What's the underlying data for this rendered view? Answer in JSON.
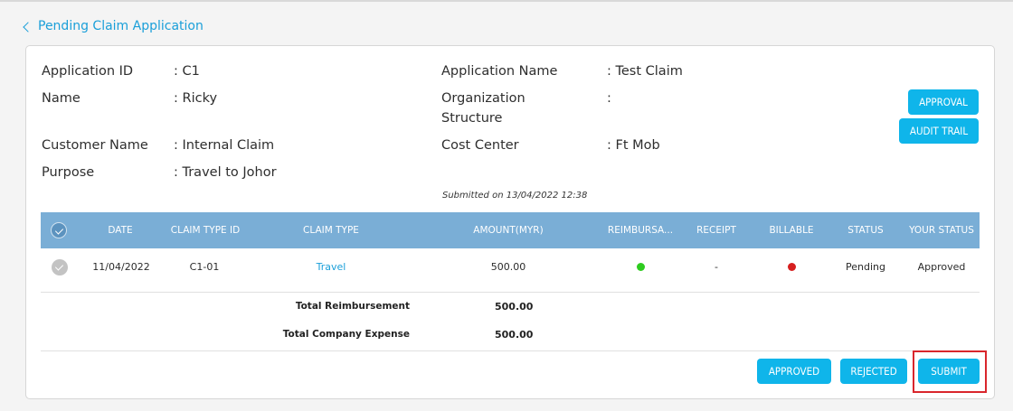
{
  "back": {
    "label": "Pending Claim Application"
  },
  "info": {
    "application_id": {
      "label": "Application ID",
      "value": ": C1"
    },
    "name": {
      "label": "Name",
      "value": ": Ricky"
    },
    "customer_name": {
      "label": "Customer Name",
      "value": ": Internal Claim"
    },
    "purpose": {
      "label": "Purpose",
      "value": ": Travel to Johor"
    },
    "application_name": {
      "label": "Application Name",
      "value": ": Test Claim"
    },
    "org_structure": {
      "label_line1": "Organization",
      "label_line2": "Structure",
      "value": ":"
    },
    "cost_center": {
      "label": "Cost Center",
      "value": ": Ft Mob"
    }
  },
  "buttons": {
    "approval": "APPROVAL",
    "audit_trail": "AUDIT TRAIL",
    "approved": "APPROVED",
    "rejected": "REJECTED",
    "submit": "SUBMIT"
  },
  "submitted_text": "Submitted on 13/04/2022 12:38",
  "table": {
    "headers": [
      "DATE",
      "CLAIM TYPE ID",
      "CLAIM TYPE",
      "AMOUNT(MYR)",
      "REIMBURSA...",
      "RECEIPT",
      "BILLABLE",
      "STATUS",
      "YOUR STATUS"
    ],
    "rows": [
      {
        "date": "11/04/2022",
        "claim_type_id": "C1-01",
        "claim_type": "Travel",
        "amount": "500.00",
        "reimbursable": "green",
        "receipt": "-",
        "billable": "red",
        "status": "Pending",
        "your_status": "Approved"
      }
    ]
  },
  "totals": {
    "reimbursement": {
      "label": "Total Reimbursement",
      "value": "500.00"
    },
    "company_expense": {
      "label": "Total Company Expense",
      "value": "500.00"
    }
  },
  "colors": {
    "accent": "#0fb5ea",
    "header_bg": "#7aaed6",
    "link": "#1a9fd9",
    "dot_green": "#2ecc1f",
    "dot_red": "#d61f1f",
    "highlight": "#d9262c"
  }
}
